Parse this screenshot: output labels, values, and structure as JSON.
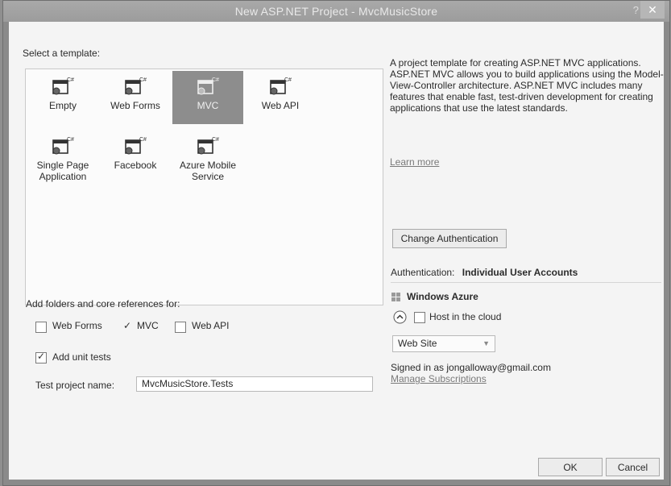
{
  "window": {
    "title": "New ASP.NET Project - MvcMusicStore",
    "help": "?",
    "close": "✕"
  },
  "template_section": {
    "label": "Select a template:"
  },
  "templates": [
    {
      "name": "Empty"
    },
    {
      "name": "Web Forms"
    },
    {
      "name": "MVC",
      "selected": true
    },
    {
      "name": "Web API"
    },
    {
      "name": "Single Page Application"
    },
    {
      "name": "Facebook"
    },
    {
      "name": "Azure Mobile Service"
    }
  ],
  "template_icon_badge": "C#",
  "description": {
    "text": "A project template for creating ASP.NET MVC applications. ASP.NET MVC allows you to build applications using the Model-View-Controller architecture. ASP.NET MVC includes many features that enable fast, test-driven development for creating applications that use the latest standards.",
    "learn_more": "Learn more"
  },
  "auth": {
    "button": "Change Authentication",
    "label": "Authentication:",
    "value": "Individual User Accounts"
  },
  "azure": {
    "title": "Windows Azure",
    "host_label": "Host in the cloud",
    "host_checked": false,
    "type_selected": "Web Site",
    "signed_in": "Signed in as jongalloway@gmail.com",
    "manage": "Manage Subscriptions"
  },
  "folders": {
    "label": "Add folders and core references for:",
    "web_forms": "Web Forms",
    "mvc": "MVC",
    "web_api": "Web API"
  },
  "unit_tests": {
    "label": "Add unit tests",
    "checked": true
  },
  "test_project": {
    "label": "Test project name:",
    "value": "MvcMusicStore.Tests"
  },
  "buttons": {
    "ok": "OK",
    "cancel": "Cancel"
  },
  "colors": {
    "selected_bg": "#8d8d8d",
    "dialog_bg": "#f4f4f4",
    "titlebar": "#a0a0a0"
  }
}
